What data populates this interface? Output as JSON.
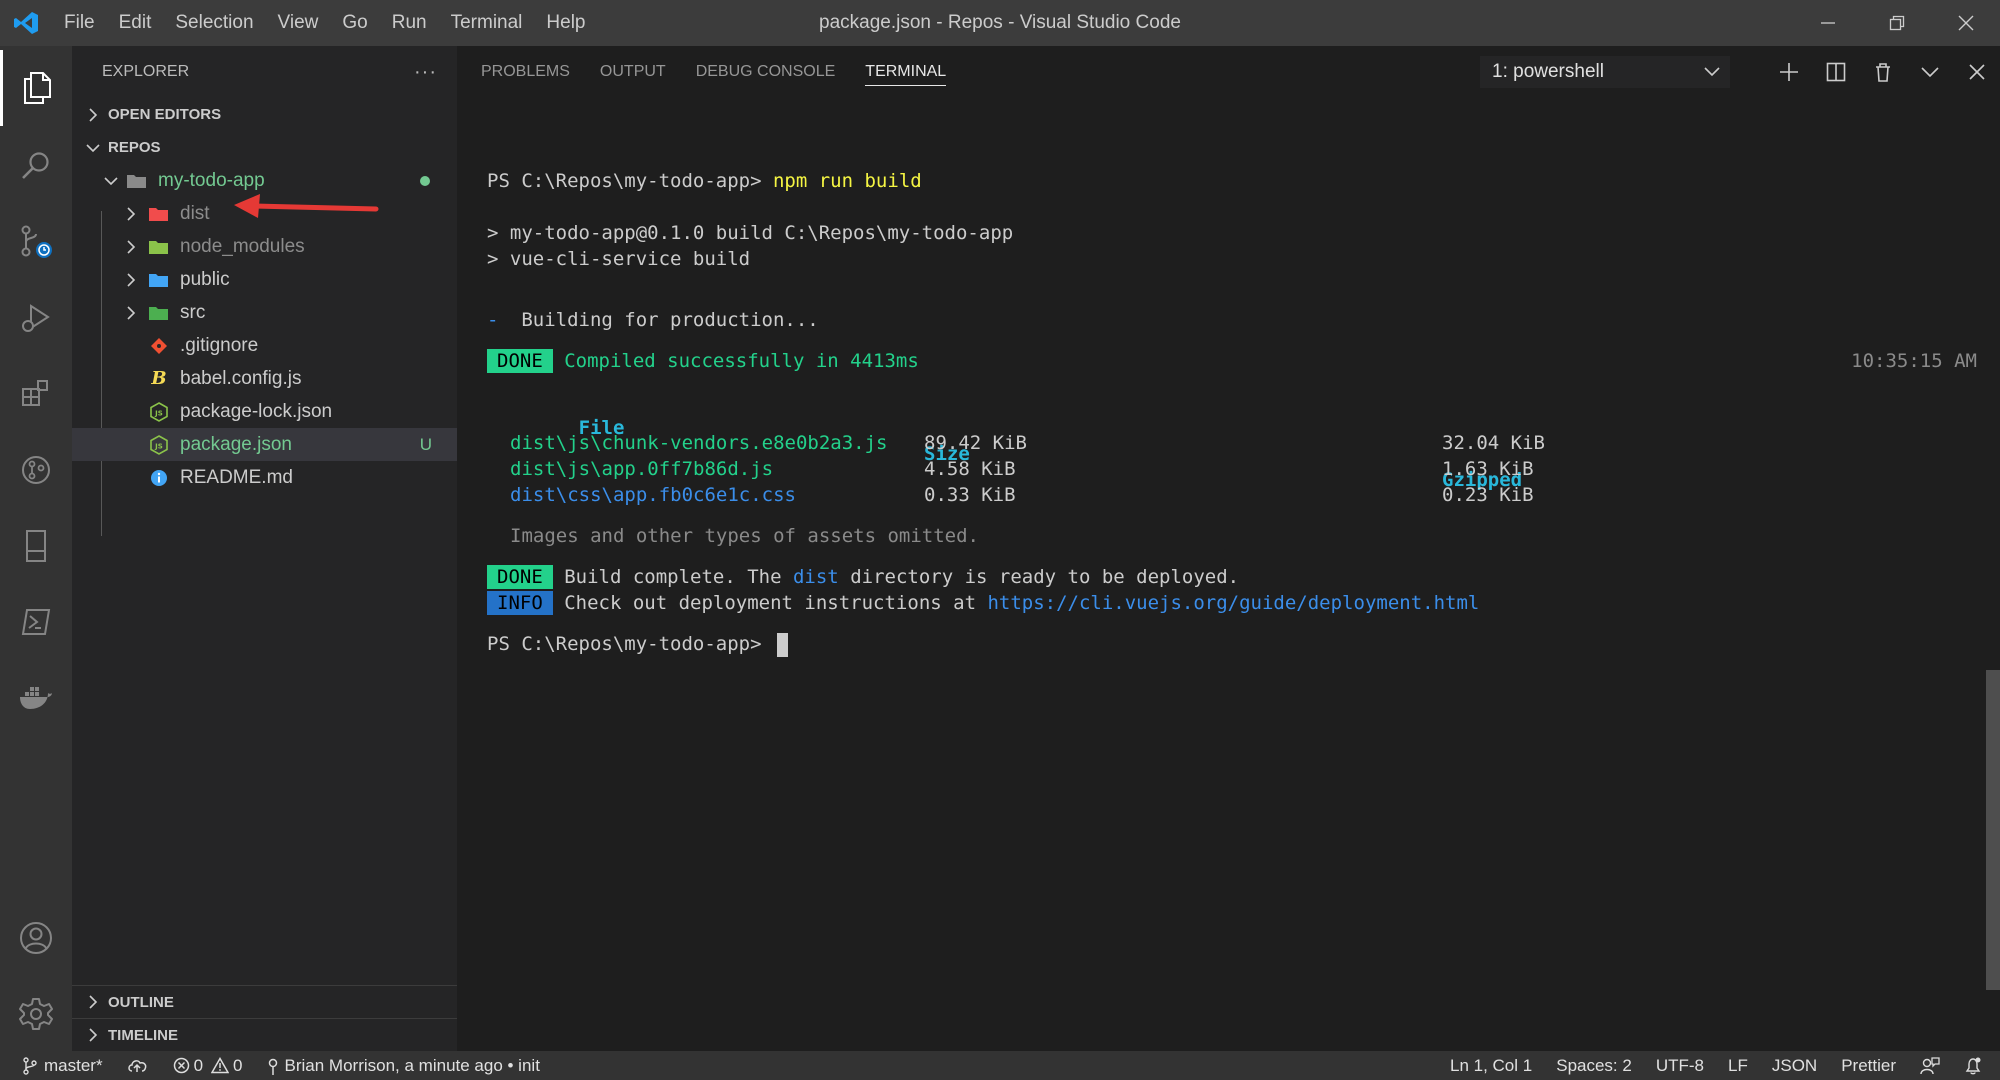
{
  "window": {
    "title": "package.json - Repos - Visual Studio Code"
  },
  "menu": [
    "File",
    "Edit",
    "Selection",
    "View",
    "Go",
    "Run",
    "Terminal",
    "Help"
  ],
  "sidebar": {
    "title": "EXPLORER",
    "more": "···",
    "open_editors": "OPEN EDITORS",
    "repos": "REPOS",
    "root_folder": "my-todo-app",
    "items": [
      {
        "label": "dist",
        "kind": "folder",
        "color": "#f14c4c",
        "text_color": "#8c8c8c"
      },
      {
        "label": "node_modules",
        "kind": "folder",
        "color": "#8bc34a",
        "text_color": "#8c8c8c"
      },
      {
        "label": "public",
        "kind": "folder",
        "color": "#42a5f5",
        "text_color": "#cccccc"
      },
      {
        "label": "src",
        "kind": "folder",
        "color": "#4caf50",
        "text_color": "#cccccc"
      },
      {
        "label": ".gitignore",
        "kind": "file",
        "icon": "git-icon",
        "text_color": "#cccccc"
      },
      {
        "label": "babel.config.js",
        "kind": "file",
        "icon": "babel-icon",
        "text_color": "#cccccc"
      },
      {
        "label": "package-lock.json",
        "kind": "file",
        "icon": "nodejs-icon",
        "text_color": "#cccccc"
      },
      {
        "label": "package.json",
        "kind": "file",
        "icon": "nodejs-icon",
        "text_color": "#73c991",
        "badge": "U"
      },
      {
        "label": "README.md",
        "kind": "file",
        "icon": "info-icon",
        "text_color": "#cccccc"
      }
    ],
    "outline": "OUTLINE",
    "timeline": "TIMELINE"
  },
  "panel": {
    "tabs": [
      "PROBLEMS",
      "OUTPUT",
      "DEBUG CONSOLE",
      "TERMINAL"
    ],
    "active_tab": "TERMINAL",
    "terminal_select": "1: powershell"
  },
  "terminal": {
    "prompt1": "PS C:\\Repos\\my-todo-app> ",
    "cmd1": "npm run build",
    "line_build1": "> my-todo-app@0.1.0 build C:\\Repos\\my-todo-app",
    "line_build2": "> vue-cli-service build",
    "building_dash": "-",
    "building": "  Building for production...",
    "done_tag": "DONE",
    "compiled": " Compiled successfully in 4413ms",
    "timestamp": "10:35:15 AM",
    "headers": {
      "file": "File",
      "size": "Size",
      "gzipped": "Gzipped"
    },
    "assets": [
      {
        "file": "dist\\js\\chunk-vendors.e8e0b2a3.js",
        "size": "89.42 KiB",
        "gzipped": "32.04 KiB",
        "color": "#23d18b"
      },
      {
        "file": "dist\\js\\app.0ff7b86d.js",
        "size": "4.58 KiB",
        "gzipped": "1.63 KiB",
        "color": "#23d18b"
      },
      {
        "file": "dist\\css\\app.fb0c6e1c.css",
        "size": "0.33 KiB",
        "gzipped": "0.23 KiB",
        "color": "#3b8eea"
      }
    ],
    "omitted": "Images and other types of assets omitted.",
    "complete_pre": " Build complete. The ",
    "complete_dist": "dist",
    "complete_post": " directory is ready to be deployed.",
    "info_tag": "INFO",
    "info_text": " Check out deployment instructions at ",
    "info_link": "https://cli.vuejs.org/guide/deployment.html",
    "prompt2": "PS C:\\Repos\\my-todo-app> "
  },
  "statusbar": {
    "branch": "master*",
    "errors": "0",
    "warnings": "0",
    "blame": "Brian Morrison, a minute ago • init",
    "position": "Ln 1, Col 1",
    "spaces": "Spaces: 2",
    "encoding": "UTF-8",
    "eol": "LF",
    "language": "JSON",
    "formatter": "Prettier"
  },
  "colors": {
    "accent": "#0078d4",
    "status_bg": "#333333",
    "done": "#23d18b",
    "info": "#2472c8",
    "arrow": "#e53935"
  }
}
